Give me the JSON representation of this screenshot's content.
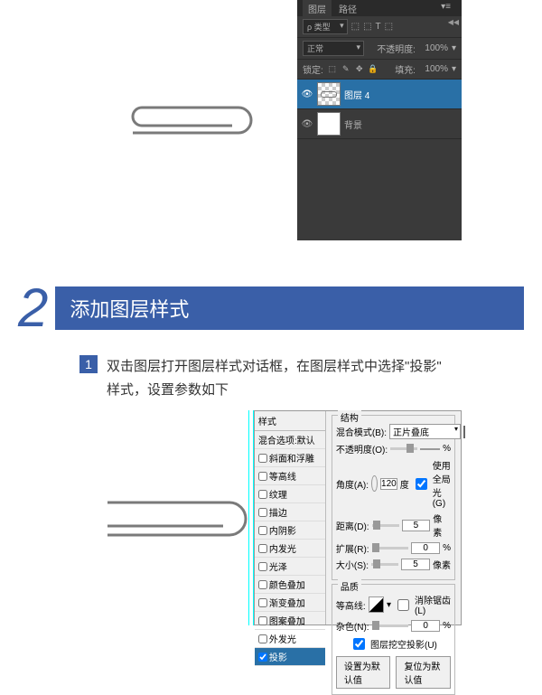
{
  "ps_panel": {
    "tab1": "图层",
    "tab2": "路径",
    "filter_label": "ρ 类型",
    "blend_mode": "正常",
    "opacity_label": "不透明度:",
    "opacity_value": "100%",
    "lock_label": "锁定:",
    "fill_label": "填充:",
    "fill_value": "100%",
    "layer1": "图层 4",
    "layer2": "背景"
  },
  "step": {
    "number": "2",
    "title": "添加图层样式",
    "sub_number": "1",
    "text_part1": "双击图层打开图层样式对话框，在图层样式中选择",
    "text_quote": "\"投影\"",
    "text_part2": "样式，设置参数如下"
  },
  "dialog": {
    "left_title": "样式",
    "options": {
      "blend_default": "混合选项:默认",
      "bevel": "斜面和浮雕",
      "contour": "等高线",
      "texture": "纹理",
      "stroke": "描边",
      "inner_shadow": "内阴影",
      "inner_glow": "内发光",
      "satin": "光泽",
      "color_overlay": "颜色叠加",
      "gradient_overlay": "渐变叠加",
      "pattern_overlay": "图案叠加",
      "outer_glow": "外发光",
      "drop_shadow": "投影"
    },
    "right": {
      "group1": "结构",
      "blend_mode_label": "混合模式(B):",
      "blend_mode_value": "正片叠底",
      "opacity_label": "不透明度(O):",
      "opacity_unit": "%",
      "angle_label": "角度(A):",
      "angle_value": "120",
      "angle_unit": "度",
      "global_light": "使用全局光(G)",
      "distance_label": "距离(D):",
      "distance_value": "5",
      "distance_unit": "像素",
      "spread_label": "扩展(R):",
      "spread_value": "0",
      "spread_unit": "%",
      "size_label": "大小(S):",
      "size_value": "5",
      "size_unit": "像素",
      "group2": "品质",
      "contour_label": "等高线:",
      "antialias": "消除锯齿(L)",
      "noise_label": "杂色(N):",
      "noise_value": "0",
      "noise_unit": "%",
      "knockout": "图层挖空投影(U)",
      "btn1": "设置为默认值",
      "btn2": "复位为默认值"
    }
  }
}
